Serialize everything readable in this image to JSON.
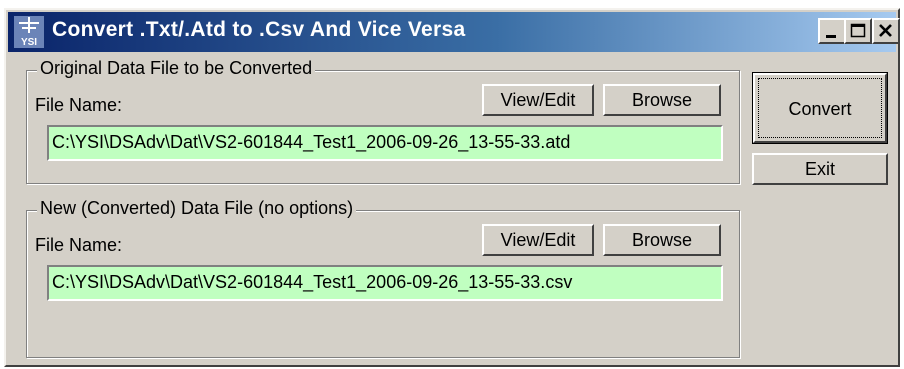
{
  "window": {
    "title": "Convert .Txt/.Atd to .Csv And Vice Versa",
    "icon": "ysi-app-icon",
    "icon_text": "YSI",
    "controls": [
      "minimize",
      "maximize",
      "close"
    ]
  },
  "group_original": {
    "legend": "Original Data File to be Converted",
    "file_label": "File Name:",
    "view_edit_label": "View/Edit",
    "browse_label": "Browse",
    "file_value": "C:\\YSI\\DSAdv\\Dat\\VS2-601844_Test1_2006-09-26_13-55-33.atd"
  },
  "group_new": {
    "legend": "New (Converted) Data File (no options)",
    "file_label": "File Name:",
    "view_edit_label": "View/Edit",
    "browse_label": "Browse",
    "file_value": "C:\\YSI\\DSAdv\\Dat\\VS2-601844_Test1_2006-09-26_13-55-33.csv"
  },
  "actions": {
    "convert_label": "Convert",
    "exit_label": "Exit"
  },
  "colors": {
    "title_start": "#0a246a",
    "title_end": "#a6caf0",
    "field_bg": "#c0ffc0",
    "face": "#d4d0c8"
  }
}
